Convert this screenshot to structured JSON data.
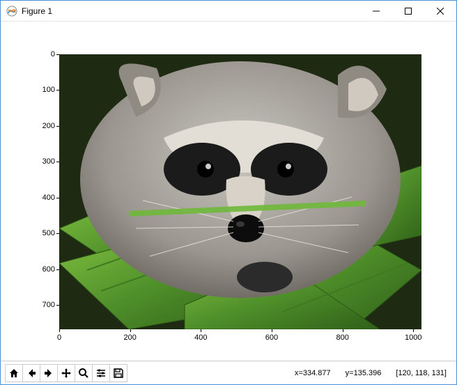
{
  "window": {
    "title": "Figure 1"
  },
  "axes": {
    "x_ticks": [
      "0",
      "200",
      "400",
      "600",
      "800",
      "1000"
    ],
    "y_ticks": [
      "0",
      "100",
      "200",
      "300",
      "400",
      "500",
      "600",
      "700"
    ],
    "x_range": [
      0,
      1023
    ],
    "y_range": [
      0,
      767
    ]
  },
  "toolbar": {
    "home": "Home",
    "back": "Back",
    "forward": "Forward",
    "pan": "Pan",
    "zoom": "Zoom",
    "configure": "Configure subplots",
    "save": "Save"
  },
  "status": {
    "x_label": "x=334.877",
    "y_label": "y=135.396",
    "pixel": "[120, 118, 131]"
  },
  "window_controls": {
    "minimize": "Minimize",
    "maximize": "Maximize",
    "close": "Close"
  },
  "image": {
    "description": "raccoon face photo"
  }
}
